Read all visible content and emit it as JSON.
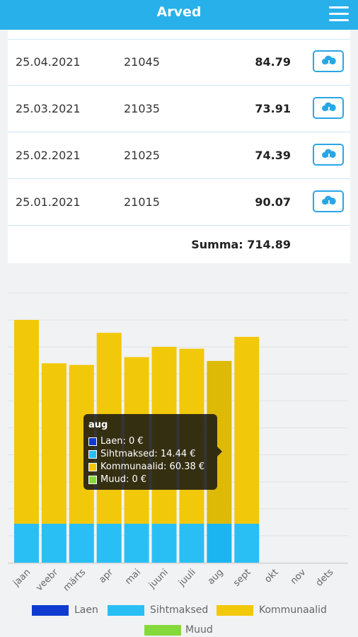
{
  "header": {
    "title": "Arved"
  },
  "invoices": [
    {
      "date": "25.04.2021",
      "number": "21045",
      "amount": "84.79"
    },
    {
      "date": "25.03.2021",
      "number": "21035",
      "amount": "73.91"
    },
    {
      "date": "25.02.2021",
      "number": "21025",
      "amount": "74.39"
    },
    {
      "date": "25.01.2021",
      "number": "21015",
      "amount": "90.07"
    }
  ],
  "summary": {
    "total_text": "Summa: 714.89"
  },
  "tooltip": {
    "title": "aug",
    "items": [
      {
        "text": "Laen: 0 €",
        "color": "#0f3bd0"
      },
      {
        "text": "Sihtmaksed: 14.44 €",
        "color": "#29bff5"
      },
      {
        "text": "Kommunaalid: 60.38 €",
        "color": "#f2c80a"
      },
      {
        "text": "Muud: 0 €",
        "color": "#86d93a"
      }
    ]
  },
  "chart_data": {
    "type": "bar",
    "stacked": true,
    "categories": [
      "jaan",
      "veebr",
      "märts",
      "apr",
      "mai",
      "juuni",
      "juuli",
      "aug",
      "sept",
      "okt",
      "nov",
      "dets"
    ],
    "series": [
      {
        "name": "Laen",
        "color": "#0f3bd0",
        "values": [
          0,
          0,
          0,
          0,
          0,
          0,
          0,
          0,
          0,
          0,
          0,
          0
        ]
      },
      {
        "name": "Sihtmaksed",
        "color": "#29bff5",
        "values": [
          14.44,
          14.44,
          14.44,
          14.44,
          14.44,
          14.44,
          14.44,
          14.44,
          14.44,
          0,
          0,
          0
        ]
      },
      {
        "name": "Kommunaalid",
        "color": "#f2c80a",
        "values": [
          75.6,
          59.5,
          58.9,
          70.8,
          61.8,
          65.6,
          64.9,
          60.38,
          69.3,
          0,
          0,
          0
        ]
      },
      {
        "name": "Muud",
        "color": "#86d93a",
        "values": [
          0,
          0,
          0,
          0,
          0,
          0,
          0,
          0,
          0,
          0,
          0,
          0
        ]
      }
    ],
    "highlight_category": "aug",
    "ylim": [
      0,
      100
    ],
    "grid": true,
    "legend_position": "bottom"
  }
}
